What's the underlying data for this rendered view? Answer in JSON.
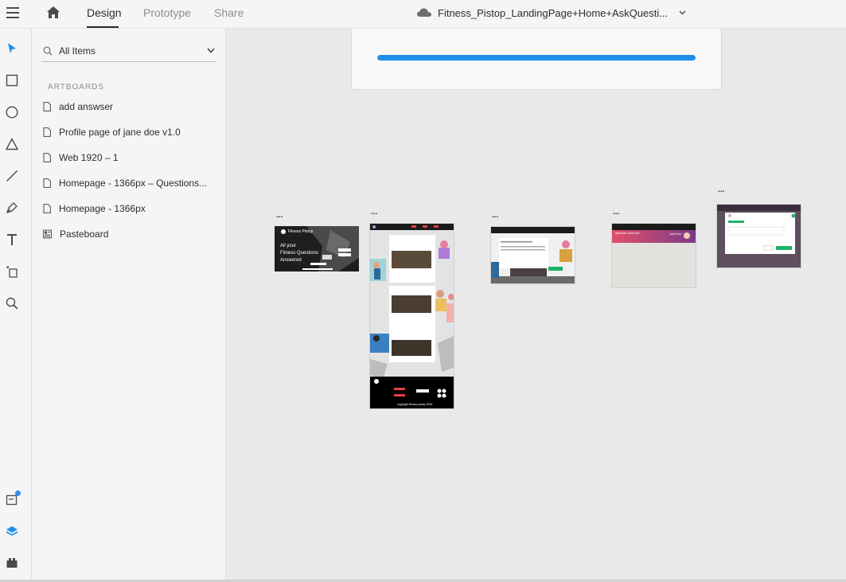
{
  "topbar": {
    "tabs": [
      {
        "label": "Design"
      },
      {
        "label": "Prototype"
      },
      {
        "label": "Share"
      }
    ],
    "document_title": "Fitness_Pistop_LandingPage+Home+AskQuesti..."
  },
  "panel": {
    "filter_label": "All Items",
    "section_title": "ARTBOARDS",
    "items": [
      {
        "label": "add answser"
      },
      {
        "label": "Profile page of jane doe v1.0"
      },
      {
        "label": "Web 1920 – 1"
      },
      {
        "label": "Homepage - 1366px – Questions..."
      },
      {
        "label": "Homepage - 1366px"
      },
      {
        "label": "Pasteboard"
      }
    ]
  },
  "canvas": {
    "upload_progress": 1.0,
    "artboard_menu_glyph": "...",
    "thumb_texts": {
      "landing_brand": "Fitness Pistop",
      "landing_headline_1": "All your",
      "landing_headline_2": "Fitness Questions",
      "landing_headline_3": "Answered",
      "footer_copyright": "copyright fitness pistop 2020",
      "profile_welcome": "Welcome Jane Doe",
      "profile_name": "Jane Doe"
    }
  },
  "colors": {
    "accent_blue": "#1f8eea",
    "badge_blue": "#378ef0",
    "profile_gradient_start": "#e0506a",
    "profile_gradient_end": "#7a3a8a",
    "green_button": "#1fb36b"
  }
}
